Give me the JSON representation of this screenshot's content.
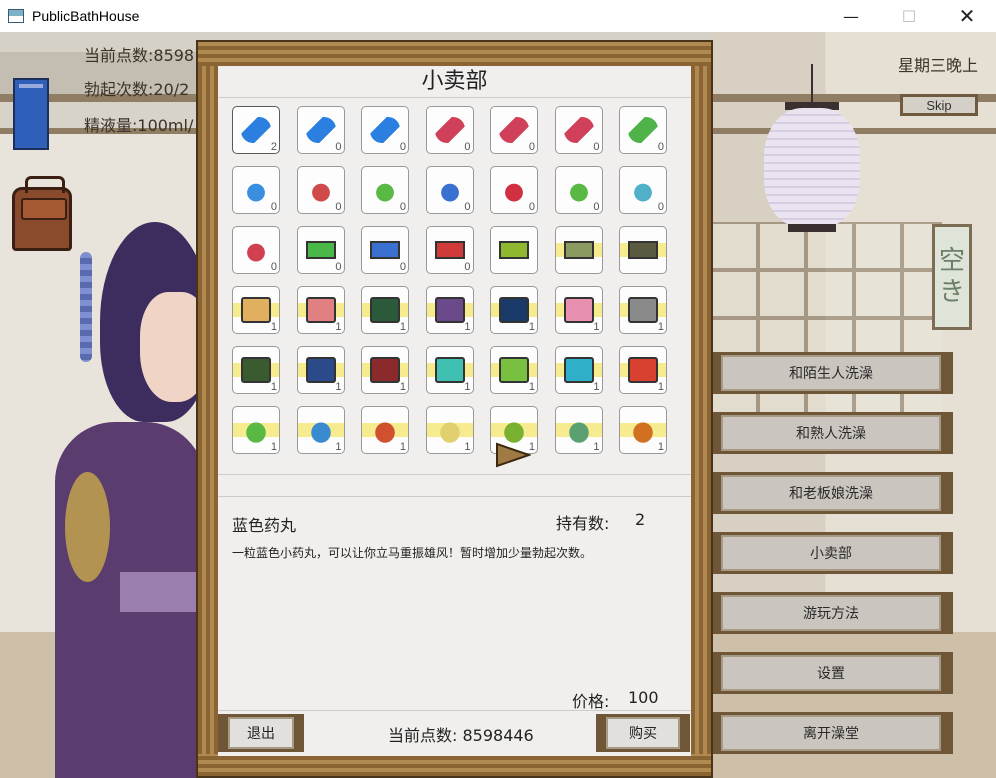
{
  "window": {
    "title": "PublicBathHouse",
    "min": "—",
    "max": "☐",
    "close": "✕"
  },
  "hud": {
    "points_line": "当前点数:8598",
    "erect_line": "勃起次数:20/2",
    "semen_line": "精液量:100ml/"
  },
  "day_label": "星期三晚上",
  "skip_label": "Skip",
  "sign_text": [
    "空",
    "き"
  ],
  "menu": [
    {
      "label": "和陌生人洗澡"
    },
    {
      "label": "和熟人洗澡"
    },
    {
      "label": "和老板娘洗澡"
    },
    {
      "label": "小卖部"
    },
    {
      "label": "游玩方法"
    },
    {
      "label": "设置"
    },
    {
      "label": "离开澡堂"
    }
  ],
  "shop": {
    "title": "小卖部",
    "items": [
      {
        "icon": "blue-pill-icon",
        "count": "2",
        "color": "#2a7fe0"
      },
      {
        "icon": "blue-pill-plus-icon",
        "count": "0",
        "color": "#2a7fe0"
      },
      {
        "icon": "gold-blue-pill-icon",
        "count": "0",
        "color": "#2a7fe0"
      },
      {
        "icon": "red-pill-icon",
        "count": "0",
        "color": "#d0405a"
      },
      {
        "icon": "red-pill-plus-icon",
        "count": "0",
        "color": "#d0405a"
      },
      {
        "icon": "gold-red-pill-icon",
        "count": "0",
        "color": "#d0405a"
      },
      {
        "icon": "green-bottle-icon",
        "count": "0",
        "color": "#4fb34a"
      },
      {
        "icon": "blue-drink-bottle-icon",
        "count": "0",
        "color": "#3a8fe0"
      },
      {
        "icon": "red-drink-bottle-icon",
        "count": "0",
        "color": "#d04a4a"
      },
      {
        "icon": "green-potion-icon",
        "count": "0",
        "color": "#5ab845"
      },
      {
        "icon": "blue-potion-icon",
        "count": "0",
        "color": "#3a70d0"
      },
      {
        "icon": "red-potion-icon",
        "count": "0",
        "color": "#d03040"
      },
      {
        "icon": "green-vial-icon",
        "count": "0",
        "color": "#5ab845"
      },
      {
        "icon": "cyan-vial-icon",
        "count": "0",
        "color": "#50b0c8"
      },
      {
        "icon": "red-vial-icon",
        "count": "0",
        "color": "#d04050"
      },
      {
        "icon": "ticket-5-icon",
        "count": "0",
        "color": "#4ab848"
      },
      {
        "icon": "ticket-10-icon",
        "count": "0",
        "color": "#3a70d0"
      },
      {
        "icon": "ticket-15-icon",
        "count": "0",
        "color": "#d03a3a"
      },
      {
        "icon": "vip-card-green-icon",
        "count": "",
        "color": "#8fb830"
      },
      {
        "icon": "vip-card-gray-icon",
        "count": "",
        "color": "#8a9a60"
      },
      {
        "icon": "vip-card-dark-icon",
        "count": "",
        "color": "#5a5a40"
      },
      {
        "icon": "doc-figure-icon",
        "count": "1",
        "color": "#e0b060"
      },
      {
        "icon": "doc-figure-pink-icon",
        "count": "1",
        "color": "#e08080"
      },
      {
        "icon": "portrait-green-icon",
        "count": "1",
        "color": "#2a5a3a"
      },
      {
        "icon": "portrait-purple-icon",
        "count": "1",
        "color": "#6a4a8a"
      },
      {
        "icon": "heart-book-icon",
        "count": "1",
        "color": "#1a3a6a"
      },
      {
        "icon": "pink-book-icon",
        "count": "1",
        "color": "#e890b0"
      },
      {
        "icon": "glasses-icon",
        "count": "1",
        "color": "#8a8a8a"
      },
      {
        "icon": "green-book-icon",
        "count": "1",
        "color": "#3a5a30"
      },
      {
        "icon": "blue-book-icon",
        "count": "1",
        "color": "#2a4a8a"
      },
      {
        "icon": "red-book-icon",
        "count": "1",
        "color": "#8a2a2a"
      },
      {
        "icon": "shell-card-cyan-icon",
        "count": "1",
        "color": "#40c0b0"
      },
      {
        "icon": "shell-card-green-icon",
        "count": "1",
        "color": "#7ac040"
      },
      {
        "icon": "shell-card-blue-icon",
        "count": "1",
        "color": "#30b0c8"
      },
      {
        "icon": "shell-card-red-icon",
        "count": "1",
        "color": "#d84030"
      },
      {
        "icon": "green-figure-icon",
        "count": "1",
        "color": "#5ab845"
      },
      {
        "icon": "blue-figure-icon",
        "count": "1",
        "color": "#3a8ad0"
      },
      {
        "icon": "red-figure-icon",
        "count": "1",
        "color": "#d05030"
      },
      {
        "icon": "white-figure-icon",
        "count": "1",
        "color": "#e0d070"
      },
      {
        "icon": "green-lips-icon",
        "count": "1",
        "color": "#7ab030"
      },
      {
        "icon": "blue-lips-icon",
        "count": "1",
        "color": "#5aa070"
      },
      {
        "icon": "red-lips-icon",
        "count": "1",
        "color": "#d07020"
      }
    ],
    "selected_name": "蓝色药丸",
    "owned_label": "持有数:",
    "owned_value": "2",
    "description": "一粒蓝色小药丸，可以让你立马重振雄风！暂时增加少量勃起次数。",
    "price_label": "价格:",
    "price_value": "100",
    "exit_label": "退出",
    "buy_label": "购买",
    "points_text": "当前点数: 8598446"
  }
}
